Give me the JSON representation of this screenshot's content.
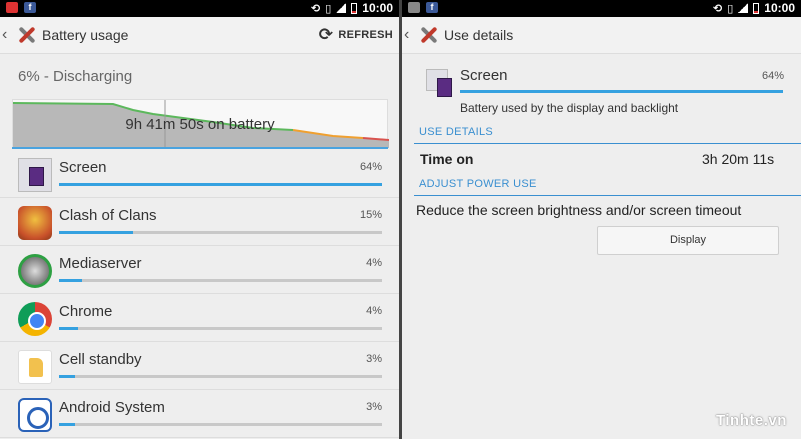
{
  "left": {
    "statusbar": {
      "time": "10:00",
      "fb": "f"
    },
    "actionbar": {
      "back": "‹",
      "title": "Battery usage",
      "refresh_label": "REFRESH",
      "refresh_icon": "⟳"
    },
    "status": "6% - Discharging",
    "graph_label": "9h 41m 50s on battery",
    "apps": [
      {
        "name": "Screen",
        "pct": "64%",
        "fill": 100,
        "icon": "screen-icon"
      },
      {
        "name": "Clash of Clans",
        "pct": "15%",
        "fill": 23,
        "icon": "clash-of-clans-icon"
      },
      {
        "name": "Mediaserver",
        "pct": "4%",
        "fill": 7,
        "icon": "mediaserver-icon"
      },
      {
        "name": "Chrome",
        "pct": "4%",
        "fill": 6,
        "icon": "chrome-icon"
      },
      {
        "name": "Cell standby",
        "pct": "3%",
        "fill": 5,
        "icon": "cell-standby-icon"
      },
      {
        "name": "Android System",
        "pct": "3%",
        "fill": 5,
        "icon": "android-system-icon"
      }
    ]
  },
  "right": {
    "statusbar": {
      "time": "10:00",
      "fb": "f"
    },
    "actionbar": {
      "back": "‹",
      "title": "Use details"
    },
    "detail": {
      "name": "Screen",
      "pct": "64%",
      "desc": "Battery used by the display and backlight"
    },
    "use_details_header": "USE DETAILS",
    "time_on_label": "Time on",
    "time_on_value": "3h 20m 11s",
    "adjust_header": "ADJUST POWER USE",
    "reduce_text": "Reduce the screen brightness and/or screen timeout",
    "display_button": "Display"
  },
  "watermark": "Tinhte.vn",
  "colors": {
    "accent": "#35a1e0",
    "graph_green": "#5cb85c",
    "graph_orange": "#f0a030",
    "graph_red": "#d9534f"
  }
}
